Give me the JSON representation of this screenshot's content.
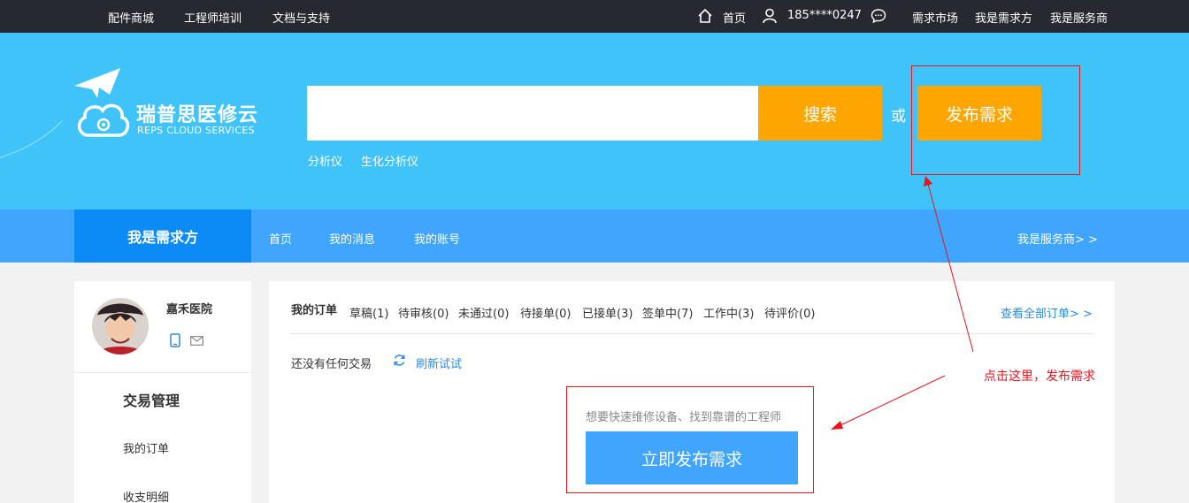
{
  "topbar": {
    "left_links": [
      "配件商城",
      "工程师培训",
      "文档与支持"
    ],
    "home": "首页",
    "phone": "185****0247",
    "right_links": [
      "需求市场",
      "我是需求方",
      "我是服务商"
    ]
  },
  "brand": {
    "name": "瑞普思医修云",
    "tagline": "REPS CLOUD SERVICES"
  },
  "search": {
    "value": "",
    "button": "搜索",
    "or": "或",
    "publish_button": "发布需求",
    "hot_keywords": [
      "分析仪",
      "生化分析仪"
    ]
  },
  "nav": {
    "active": "我是需求方",
    "links": [
      "首页",
      "我的消息",
      "我的账号"
    ],
    "switch_role": "我是服务商> >"
  },
  "sidebar": {
    "org_name": "嘉禾医院",
    "section_title": "交易管理",
    "items": [
      "我的订单",
      "收支明细"
    ]
  },
  "orders": {
    "title": "我的订单",
    "statuses": [
      "草稿(1)",
      "待审核(0)",
      "未通过(0)",
      "待接单(0)",
      "已接单(3)",
      "签单中(7)",
      "工作中(3)",
      "待评价(0)"
    ],
    "view_all": "查看全部订单> >",
    "empty": "还没有任何交易",
    "refresh": "刷新试试",
    "promo": "想要快速维修设备、找到靠谱的工程师",
    "publish_now": "立即发布需求"
  },
  "annotation": "点击这里，发布需求",
  "colors": {
    "topbar": "#262a30",
    "hero": "#3fc3f9",
    "nav": "#3fa5fd",
    "nav_active": "#0a8bf5",
    "orange": "#fda500",
    "link": "#2a8ae0",
    "annotation": "#e8141e"
  }
}
